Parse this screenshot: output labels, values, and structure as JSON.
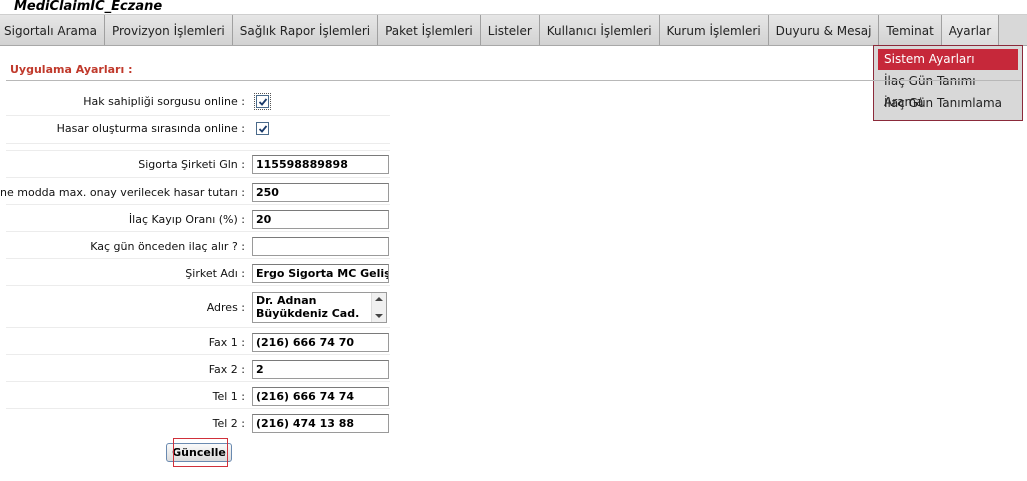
{
  "app": {
    "title": "MediClaimIC_Eczane"
  },
  "menu": [
    "Sigortalı Arama",
    "Provizyon İşlemleri",
    "Sağlık Rapor İşlemleri",
    "Paket İşlemleri",
    "Listeler",
    "Kullanıcı İşlemleri",
    "Kurum İşlemleri",
    "Duyuru & Mesaj",
    "Teminat",
    "Ayarlar"
  ],
  "dropdown": {
    "items": [
      "Sistem Ayarları",
      "İlaç Gün Tanımı Arama",
      "İlaç Gün Tanımlama"
    ],
    "selected_index": 0
  },
  "section": {
    "title": "Uygulama Ayarları :"
  },
  "form": {
    "hak_sahipligi": {
      "label": "Hak sahipliği sorgusu online :",
      "checked": true
    },
    "hasar_olusturma": {
      "label": "Hasar oluşturma sırasında online :",
      "checked": true
    },
    "gln": {
      "label": "Sigorta Şirketi Gln :",
      "value": "115598889898"
    },
    "offline_max": {
      "label": "Offline modda max. onay verilecek hasar tutarı :",
      "value": "250"
    },
    "kayip_orani": {
      "label": "İlaç Kayıp Oranı (%) :",
      "value": "20"
    },
    "kac_gun": {
      "label": "Kaç gün önceden ilaç alır ? :",
      "value": ""
    },
    "sirket_adi": {
      "label": "Şirket Adı :",
      "value": "Ergo Sigorta MC Geliştir"
    },
    "adres": {
      "label": "Adres :",
      "value": "Dr. Adnan\nBüyükdeniz Cad."
    },
    "fax1": {
      "label": "Fax 1 :",
      "value": "(216) 666 74 70"
    },
    "fax2": {
      "label": "Fax 2 :",
      "value": "2"
    },
    "tel1": {
      "label": "Tel 1 :",
      "value": "(216) 666 74 74"
    },
    "tel2": {
      "label": "Tel 2 :",
      "value": "(216) 474 13 88"
    }
  },
  "buttons": {
    "update": "Güncelle"
  },
  "colors": {
    "accent_red": "#c6283a",
    "section_title": "#c0392b",
    "menu_bg": "#d8d8d8"
  }
}
